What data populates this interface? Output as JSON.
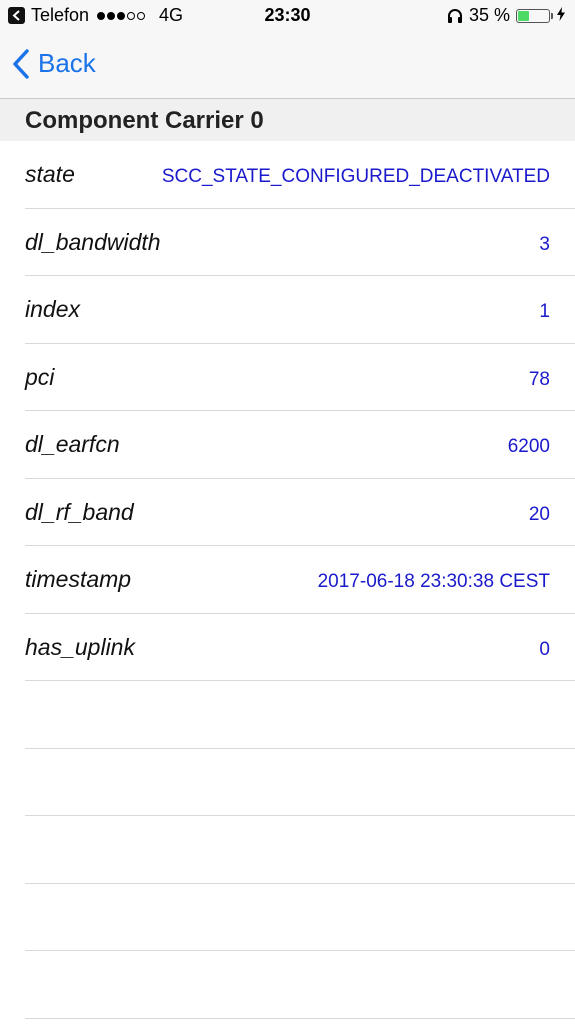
{
  "status_bar": {
    "carrier": "Telefon",
    "network": "4G",
    "time": "23:30",
    "battery_percent": "35 %",
    "battery_level": 0.35,
    "signal_bars_filled": 3,
    "signal_bars_total": 5
  },
  "nav": {
    "back_label": "Back",
    "accent_color": "#1a73e8"
  },
  "section": {
    "title": "Component Carrier 0"
  },
  "rows": [
    {
      "key": "state",
      "value": "SCC_STATE_CONFIGURED_DEACTIVATED"
    },
    {
      "key": "dl_bandwidth",
      "value": "3"
    },
    {
      "key": "index",
      "value": "1"
    },
    {
      "key": "pci",
      "value": "78"
    },
    {
      "key": "dl_earfcn",
      "value": "6200"
    },
    {
      "key": "dl_rf_band",
      "value": "20"
    },
    {
      "key": "timestamp",
      "value": "2017-06-18 23:30:38 CEST"
    },
    {
      "key": "has_uplink",
      "value": "0"
    },
    {
      "key": "",
      "value": ""
    },
    {
      "key": "",
      "value": ""
    },
    {
      "key": "",
      "value": ""
    },
    {
      "key": "",
      "value": ""
    },
    {
      "key": "",
      "value": ""
    }
  ]
}
